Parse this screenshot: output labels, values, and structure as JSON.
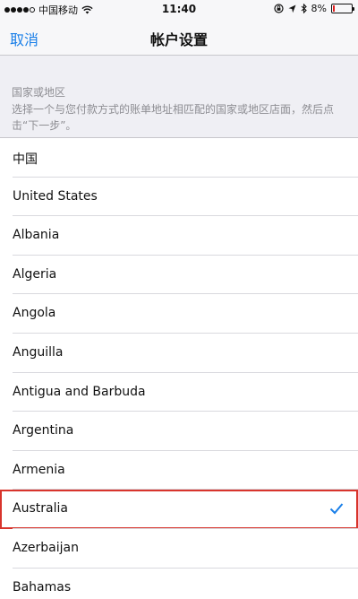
{
  "status_bar": {
    "carrier": "中国移动",
    "time": "11:40",
    "battery_percent": "8%",
    "battery_level": 0.08
  },
  "nav": {
    "cancel_label": "取消",
    "title": "帐户设置"
  },
  "section": {
    "title": "国家或地区",
    "description": "选择一个与您付款方式的账单地址相匹配的国家或地区店面，然后点击“下一步”。"
  },
  "countries": [
    {
      "label": "中国",
      "selected": false
    },
    {
      "label": "United States",
      "selected": false
    },
    {
      "label": "Albania",
      "selected": false
    },
    {
      "label": "Algeria",
      "selected": false
    },
    {
      "label": "Angola",
      "selected": false
    },
    {
      "label": "Anguilla",
      "selected": false
    },
    {
      "label": "Antigua and Barbuda",
      "selected": false
    },
    {
      "label": "Argentina",
      "selected": false
    },
    {
      "label": "Armenia",
      "selected": false
    },
    {
      "label": "Australia",
      "selected": true
    },
    {
      "label": "Azerbaijan",
      "selected": false
    },
    {
      "label": "Bahamas",
      "selected": false
    }
  ],
  "colors": {
    "accent": "#1a7fe8",
    "highlight": "#d8342c"
  }
}
